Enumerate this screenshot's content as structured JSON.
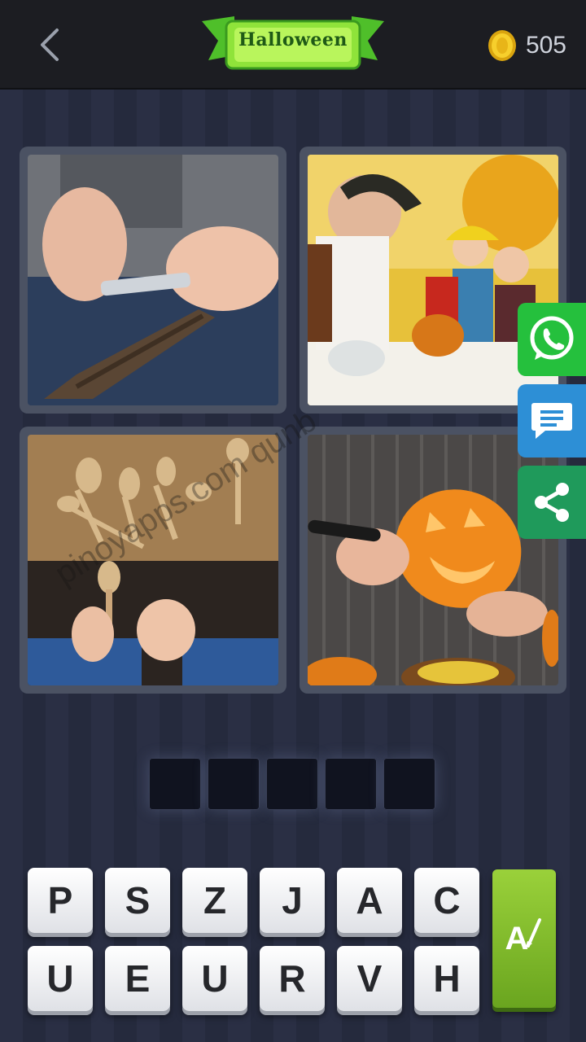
{
  "header": {
    "category_title": "Halloween",
    "coin_count": "505",
    "back_icon": "chevron-left-icon",
    "coin_icon": "gold-coin-icon"
  },
  "photos": [
    {
      "subject": "hands carving a stick with a knife"
    },
    {
      "subject": "man in pirate costume carving pumpkin with children"
    },
    {
      "subject": "carved wooden spoons and wood shavings"
    },
    {
      "subject": "hands carving a jack-o-lantern pumpkin"
    }
  ],
  "side_buttons": [
    {
      "icon": "whatsapp-icon",
      "color": "#25c03d"
    },
    {
      "icon": "message-icon",
      "color": "#2d8fd6"
    },
    {
      "icon": "share-icon",
      "color": "#1f9a5b"
    }
  ],
  "answer_slots": [
    "",
    "",
    "",
    "",
    ""
  ],
  "letters_row1": [
    "P",
    "S",
    "Z",
    "J",
    "A",
    "C"
  ],
  "letters_row2": [
    "U",
    "E",
    "U",
    "R",
    "V",
    "H"
  ],
  "hint_button": {
    "letter": "A",
    "icon": "brush-icon",
    "color": "#8cc63a"
  },
  "watermark": "pinoyapps.com qunb"
}
